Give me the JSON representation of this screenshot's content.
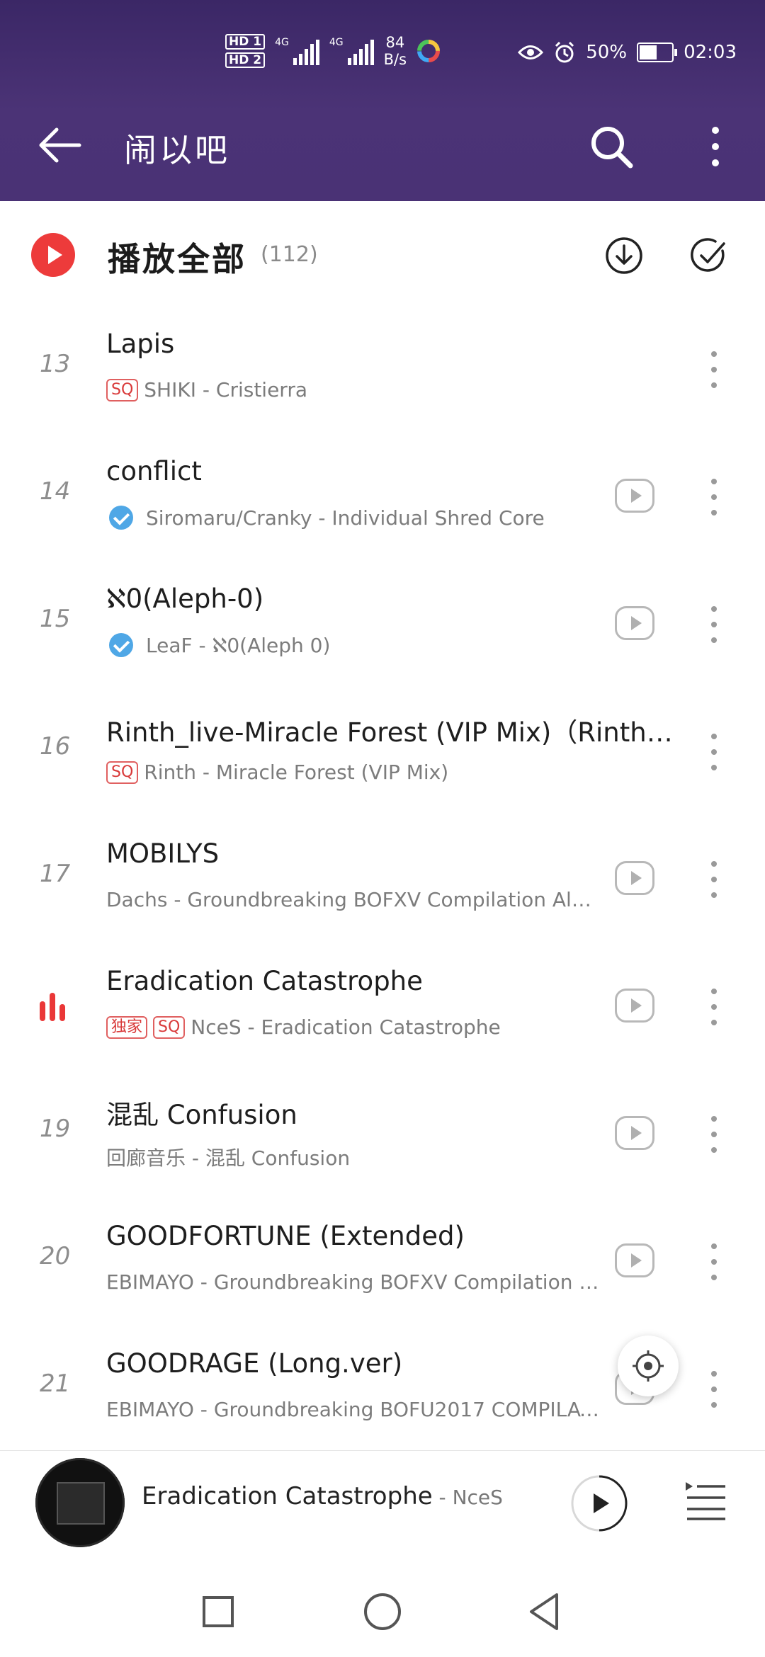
{
  "status_bar": {
    "hd1": "HD 1",
    "hd2": "HD 2",
    "net1": "4G",
    "net2": "4G",
    "speed_value": "84",
    "speed_unit": "B/s",
    "battery": "50%",
    "time": "02:03"
  },
  "header": {
    "title": "闹以吧",
    "back_icon": "arrow-left-icon",
    "search_icon": "search-icon",
    "more_icon": "more-vertical-icon"
  },
  "play_all": {
    "label": "播放全部",
    "count": "(112)",
    "download_icon": "download-icon",
    "select_icon": "multi-select-check-icon"
  },
  "songs": [
    {
      "num": "13",
      "title": "Lapis",
      "badges": [
        "SQ"
      ],
      "verified": false,
      "subtitle": "SHIKI - Cristierra",
      "has_video": false,
      "playing": false
    },
    {
      "num": "14",
      "title": "conflict",
      "badges": [],
      "verified": true,
      "subtitle": "Siromaru/Cranky - Individual Shred Core",
      "has_video": true,
      "playing": false
    },
    {
      "num": "15",
      "title": "ℵ0(Aleph-0)",
      "badges": [],
      "verified": true,
      "subtitle": "LeaF - ℵ0(Aleph 0)",
      "has_video": true,
      "playing": false
    },
    {
      "num": "16",
      "title": "Rinth_live-Miracle Forest (VIP Mix)（Rinth_liv…",
      "badges": [
        "SQ"
      ],
      "verified": false,
      "subtitle": "Rinth - Miracle Forest (VIP Mix)",
      "has_video": false,
      "playing": false
    },
    {
      "num": "17",
      "title": "MOBILYS",
      "badges": [],
      "verified": false,
      "subtitle": "Dachs - Groundbreaking BOFXV Compilation Album",
      "has_video": true,
      "playing": false
    },
    {
      "num": "",
      "title": "Eradication Catastrophe",
      "badges": [
        "独家",
        "SQ"
      ],
      "verified": false,
      "subtitle": "NceS - Eradication Catastrophe",
      "has_video": true,
      "playing": true
    },
    {
      "num": "19",
      "title": "混乱 Confusion",
      "badges": [],
      "verified": false,
      "subtitle": "回廊音乐 - 混乱 Confusion",
      "has_video": true,
      "playing": false
    },
    {
      "num": "20",
      "title": "GOODFORTUNE (Extended)",
      "badges": [],
      "verified": false,
      "subtitle": "EBIMAYO - Groundbreaking BOFXV Compilation Album",
      "has_video": true,
      "playing": false
    },
    {
      "num": "21",
      "title": "GOODRAGE (Long.ver)",
      "badges": [],
      "verified": false,
      "subtitle": "EBIMAYO - Groundbreaking BOFU2017 COMPILATION A…",
      "has_video": true,
      "playing": false
    }
  ],
  "now_playing": {
    "title": "Eradication Catastrophe",
    "separator": " - ",
    "artist": "NceS",
    "play_icon": "play-icon",
    "queue_icon": "playlist-icon"
  },
  "nav": {
    "recent_icon": "square-recents-icon",
    "home_icon": "circle-home-icon",
    "back_icon": "triangle-back-icon"
  },
  "colors": {
    "header_bg": "#45306f",
    "accent": "#ed3b3b",
    "verified": "#4fa7e6"
  }
}
